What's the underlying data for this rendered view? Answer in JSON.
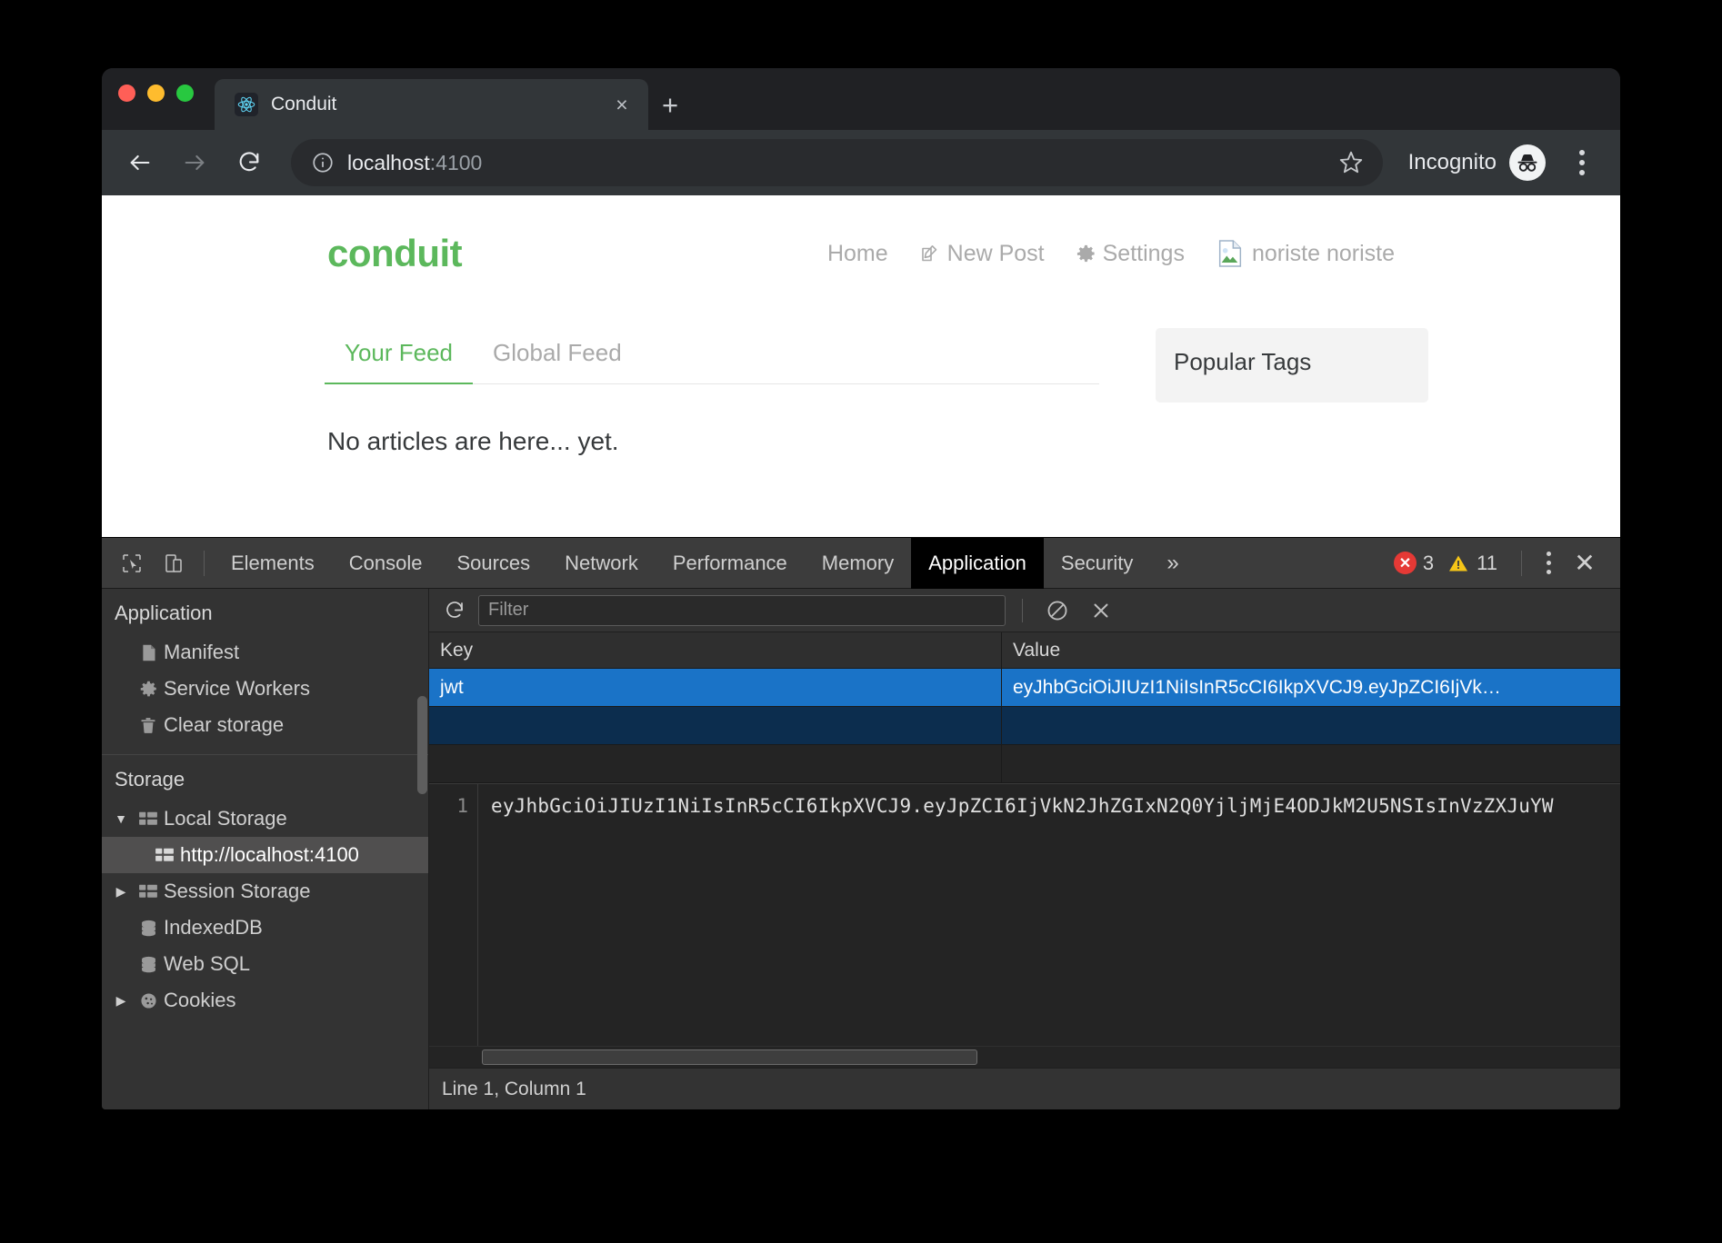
{
  "browser": {
    "traffic_lights": [
      "close",
      "minimize",
      "zoom"
    ],
    "tab": {
      "title": "Conduit",
      "favicon": "react-logo-icon",
      "close_label": "×"
    },
    "new_tab_label": "+",
    "toolbar": {
      "back_icon": "back-arrow-icon",
      "forward_icon": "forward-arrow-icon",
      "reload_icon": "reload-icon",
      "info_icon": "info-circle-icon",
      "url_host": "localhost",
      "url_port": ":4100",
      "bookmark_icon": "star-outline-icon",
      "incognito_label": "Incognito",
      "incognito_icon": "incognito-hat-glasses-icon",
      "menu_icon": "kebab-menu-icon"
    }
  },
  "page": {
    "brand": "conduit",
    "nav": [
      {
        "label": "Home",
        "icon": null
      },
      {
        "label": "New Post",
        "icon": "compose-icon"
      },
      {
        "label": "Settings",
        "icon": "gear-icon"
      },
      {
        "label": "noriste noriste",
        "icon": "broken-image-icon"
      }
    ],
    "feed_tabs": [
      {
        "label": "Your Feed",
        "active": true
      },
      {
        "label": "Global Feed",
        "active": false
      }
    ],
    "empty_message": "No articles are here... yet.",
    "sidebar": {
      "title": "Popular Tags"
    },
    "accent_color": "#5cb85c"
  },
  "devtools": {
    "tabs": [
      {
        "label": "Elements",
        "active": false
      },
      {
        "label": "Console",
        "active": false
      },
      {
        "label": "Sources",
        "active": false
      },
      {
        "label": "Network",
        "active": false
      },
      {
        "label": "Performance",
        "active": false
      },
      {
        "label": "Memory",
        "active": false
      },
      {
        "label": "Application",
        "active": true
      },
      {
        "label": "Security",
        "active": false
      }
    ],
    "more_tabs_label": "»",
    "inspect_icon": "inspect-cursor-icon",
    "device_toolbar_icon": "device-toggle-icon",
    "errors_count": "3",
    "warnings_count": "11",
    "error_color": "#e53935",
    "warning_color": "#f5c518",
    "kebab_icon": "kebab-menu-icon",
    "close_icon": "close-icon",
    "sidebar": {
      "application_title": "Application",
      "application_items": [
        {
          "label": "Manifest",
          "icon": "manifest-file-icon"
        },
        {
          "label": "Service Workers",
          "icon": "gear-icon"
        },
        {
          "label": "Clear storage",
          "icon": "trash-icon"
        }
      ],
      "storage_title": "Storage",
      "storage_items": [
        {
          "label": "Local Storage",
          "icon": "table-icon",
          "arrow": "expanded",
          "selected": false,
          "indent": 0
        },
        {
          "label": "http://localhost:4100",
          "icon": "table-icon",
          "arrow": "none",
          "selected": true,
          "indent": 1
        },
        {
          "label": "Session Storage",
          "icon": "table-icon",
          "arrow": "collapsed",
          "selected": false,
          "indent": 0
        },
        {
          "label": "IndexedDB",
          "icon": "database-icon",
          "arrow": "none",
          "selected": false,
          "indent": 0
        },
        {
          "label": "Web SQL",
          "icon": "database-icon",
          "arrow": "none",
          "selected": false,
          "indent": 0
        },
        {
          "label": "Cookies",
          "icon": "cookie-icon",
          "arrow": "collapsed",
          "selected": false,
          "indent": 0
        }
      ]
    },
    "storage_panel": {
      "refresh_icon": "refresh-icon",
      "filter_placeholder": "Filter",
      "filter_value": "",
      "clear_all_icon": "no-entry-icon",
      "delete_selected_icon": "close-icon",
      "columns": [
        "Key",
        "Value"
      ],
      "rows": [
        {
          "key": "jwt",
          "value": "eyJhbGciOiJIUzI1NiIsInR5cCI6IkpXVCJ9.eyJpZCI6IjVk…",
          "selected": true
        },
        {
          "key": "",
          "value": "",
          "selected": false
        }
      ],
      "preview": {
        "line_number": "1",
        "text": "eyJhbGciOiJIUzI1NiIsInR5cCI6IkpXVCJ9.eyJpZCI6IjVkN2JhZGIxN2Q0YjljMjE4ODJkM2U5NSIsInVzZXJuYW"
      },
      "status": "Line 1, Column 1"
    }
  }
}
